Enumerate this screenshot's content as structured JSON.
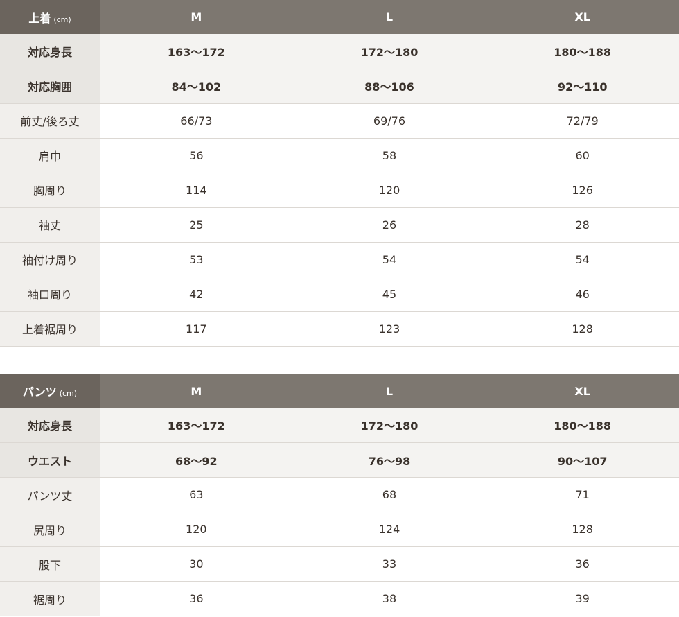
{
  "jacket": {
    "title": "上着",
    "unit": "(cm)",
    "sizes": [
      "M",
      "L",
      "XL"
    ],
    "rows": [
      {
        "label": "対応身長",
        "values": [
          "163〜172",
          "172〜180",
          "180〜188"
        ]
      },
      {
        "label": "対応胸囲",
        "values": [
          "84〜102",
          "88〜106",
          "92〜110"
        ]
      },
      {
        "label": "前丈/後ろ丈",
        "values": [
          "66/73",
          "69/76",
          "72/79"
        ]
      },
      {
        "label": "肩巾",
        "values": [
          "56",
          "58",
          "60"
        ]
      },
      {
        "label": "胸周り",
        "values": [
          "114",
          "120",
          "126"
        ]
      },
      {
        "label": "袖丈",
        "values": [
          "25",
          "26",
          "28"
        ]
      },
      {
        "label": "袖付け周り",
        "values": [
          "53",
          "54",
          "54"
        ]
      },
      {
        "label": "袖口周り",
        "values": [
          "42",
          "45",
          "46"
        ]
      },
      {
        "label": "上着裾周り",
        "values": [
          "117",
          "123",
          "128"
        ]
      }
    ]
  },
  "pants": {
    "title": "パンツ",
    "unit": "(cm)",
    "sizes": [
      "M",
      "L",
      "XL"
    ],
    "rows": [
      {
        "label": "対応身長",
        "values": [
          "163〜172",
          "172〜180",
          "180〜188"
        ]
      },
      {
        "label": "ウエスト",
        "values": [
          "68〜92",
          "76〜98",
          "90〜107"
        ]
      },
      {
        "label": "パンツ丈",
        "values": [
          "63",
          "68",
          "71"
        ]
      },
      {
        "label": "尻周り",
        "values": [
          "120",
          "124",
          "128"
        ]
      },
      {
        "label": "股下",
        "values": [
          "30",
          "33",
          "36"
        ]
      },
      {
        "label": "裾周り",
        "values": [
          "36",
          "38",
          "39"
        ]
      }
    ]
  }
}
